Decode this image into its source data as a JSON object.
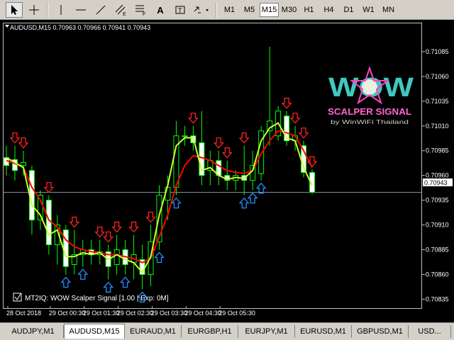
{
  "toolbar": {
    "timeframes": [
      "M1",
      "M5",
      "M15",
      "M30",
      "H1",
      "H4",
      "D1",
      "W1",
      "MN"
    ],
    "selected_timeframe": "M15",
    "text_tool_label": "A"
  },
  "chart": {
    "header": "AUDUSD,M15  0.70963 0.70966 0.70941 0.70943",
    "indicator_label": "MT2IQ: WOW Scalper Signal [1.00 | Exp: 0M]",
    "current_price": "0.70943",
    "logo": {
      "brand": "WOW",
      "tagline": "SCALPER SIGNAL",
      "byline": "by WinWiFi Thailand"
    },
    "colors": {
      "bull": "#00ff00",
      "bear": "#00ff00",
      "fast_line": "#ccff33",
      "slow_line": "#ff0000",
      "up_arrow": "#1e90ff",
      "down_arrow": "#ff2020",
      "bg": "#000000",
      "grid_text": "#ffffff"
    }
  },
  "chart_data": {
    "type": "candlestick",
    "symbol": "AUDUSD",
    "timeframe": "M15",
    "y_ticks": [
      "0.71085",
      "0.71060",
      "0.71035",
      "0.71010",
      "0.70985",
      "0.70960",
      "0.70935",
      "0.70910",
      "0.70885",
      "0.70860",
      "0.70835"
    ],
    "x_ticks": [
      "28 Oct 2018",
      "29 Oct 00:30",
      "29 Oct 01:30",
      "29 Oct 02:30",
      "29 Oct 03:30",
      "29 Oct 04:30",
      "29 Oct 05:30"
    ],
    "ylim": [
      0.70826,
      0.71115
    ],
    "candles": [
      {
        "o": 0.70978,
        "h": 0.7099,
        "l": 0.7096,
        "c": 0.7097
      },
      {
        "o": 0.70976,
        "h": 0.7099,
        "l": 0.70955,
        "c": 0.70965
      },
      {
        "o": 0.7097,
        "h": 0.70985,
        "l": 0.7096,
        "c": 0.70973
      },
      {
        "o": 0.70965,
        "h": 0.7097,
        "l": 0.709,
        "c": 0.70915
      },
      {
        "o": 0.70915,
        "h": 0.70945,
        "l": 0.70905,
        "c": 0.7094
      },
      {
        "o": 0.70935,
        "h": 0.7094,
        "l": 0.7088,
        "c": 0.7089
      },
      {
        "o": 0.7089,
        "h": 0.7092,
        "l": 0.7087,
        "c": 0.7091
      },
      {
        "o": 0.70905,
        "h": 0.7091,
        "l": 0.7086,
        "c": 0.70868
      },
      {
        "o": 0.7087,
        "h": 0.70905,
        "l": 0.7086,
        "c": 0.7088
      },
      {
        "o": 0.7088,
        "h": 0.70895,
        "l": 0.70868,
        "c": 0.70885
      },
      {
        "o": 0.70885,
        "h": 0.70895,
        "l": 0.7087,
        "c": 0.7088
      },
      {
        "o": 0.7088,
        "h": 0.70895,
        "l": 0.7087,
        "c": 0.70883
      },
      {
        "o": 0.70883,
        "h": 0.7089,
        "l": 0.70855,
        "c": 0.70868
      },
      {
        "o": 0.7087,
        "h": 0.709,
        "l": 0.7086,
        "c": 0.70885
      },
      {
        "o": 0.70885,
        "h": 0.70895,
        "l": 0.7086,
        "c": 0.7087
      },
      {
        "o": 0.70872,
        "h": 0.709,
        "l": 0.70855,
        "c": 0.7088
      },
      {
        "o": 0.70875,
        "h": 0.7089,
        "l": 0.70845,
        "c": 0.7086
      },
      {
        "o": 0.7086,
        "h": 0.7091,
        "l": 0.70848,
        "c": 0.70893
      },
      {
        "o": 0.70893,
        "h": 0.7095,
        "l": 0.70885,
        "c": 0.7094
      },
      {
        "o": 0.70935,
        "h": 0.7096,
        "l": 0.70915,
        "c": 0.70948
      },
      {
        "o": 0.70948,
        "h": 0.71015,
        "l": 0.7094,
        "c": 0.71
      },
      {
        "o": 0.71,
        "h": 0.7101,
        "l": 0.7099,
        "c": 0.71
      },
      {
        "o": 0.71,
        "h": 0.7101,
        "l": 0.70985,
        "c": 0.70993
      },
      {
        "o": 0.70993,
        "h": 0.71025,
        "l": 0.7095,
        "c": 0.7096
      },
      {
        "o": 0.70965,
        "h": 0.70985,
        "l": 0.7095,
        "c": 0.70975
      },
      {
        "o": 0.70975,
        "h": 0.70985,
        "l": 0.7095,
        "c": 0.7096
      },
      {
        "o": 0.7096,
        "h": 0.70975,
        "l": 0.70945,
        "c": 0.70955
      },
      {
        "o": 0.70955,
        "h": 0.70965,
        "l": 0.70945,
        "c": 0.7096
      },
      {
        "o": 0.7096,
        "h": 0.7099,
        "l": 0.7094,
        "c": 0.70955
      },
      {
        "o": 0.70955,
        "h": 0.70985,
        "l": 0.70945,
        "c": 0.7097
      },
      {
        "o": 0.70962,
        "h": 0.7101,
        "l": 0.70955,
        "c": 0.71005
      },
      {
        "o": 0.71005,
        "h": 0.7109,
        "l": 0.7099,
        "c": 0.71015
      },
      {
        "o": 0.71,
        "h": 0.7103,
        "l": 0.70995,
        "c": 0.71025
      },
      {
        "o": 0.7102,
        "h": 0.71025,
        "l": 0.7099,
        "c": 0.70995
      },
      {
        "o": 0.70995,
        "h": 0.7101,
        "l": 0.70985,
        "c": 0.71
      },
      {
        "o": 0.7099,
        "h": 0.70995,
        "l": 0.70958,
        "c": 0.70963
      },
      {
        "o": 0.70963,
        "h": 0.70966,
        "l": 0.70941,
        "c": 0.70943
      }
    ],
    "fast_line": [
      0.70978,
      0.70973,
      0.70968,
      0.7093,
      0.7092,
      0.709,
      0.70905,
      0.70878,
      0.70878,
      0.70882,
      0.7088,
      0.70882,
      0.70875,
      0.7088,
      0.70875,
      0.70872,
      0.70862,
      0.70878,
      0.7092,
      0.7095,
      0.7099,
      0.70998,
      0.70998,
      0.70965,
      0.70968,
      0.7096,
      0.70956,
      0.70958,
      0.70957,
      0.70965,
      0.70995,
      0.71008,
      0.71013,
      0.70998,
      0.70995,
      0.70968,
      0.7095
    ],
    "slow_line": [
      0.70975,
      0.70972,
      0.70968,
      0.70948,
      0.70935,
      0.70915,
      0.70908,
      0.70895,
      0.70888,
      0.70885,
      0.70883,
      0.70882,
      0.7088,
      0.7088,
      0.70878,
      0.70876,
      0.70872,
      0.70876,
      0.70898,
      0.7092,
      0.7095,
      0.7097,
      0.7098,
      0.70978,
      0.70975,
      0.7097,
      0.70965,
      0.70963,
      0.70962,
      0.70965,
      0.70982,
      0.70995,
      0.71005,
      0.71003,
      0.71,
      0.70985,
      0.70968
    ],
    "sell_signals": [
      1,
      2,
      5,
      8,
      11,
      12,
      13,
      15,
      17,
      22,
      25,
      26,
      28,
      33,
      34,
      35,
      36
    ],
    "buy_signals": [
      7,
      9,
      12,
      14,
      16,
      18,
      20,
      28,
      29,
      30
    ]
  },
  "tabs": {
    "items": [
      "AUDJPY,M1",
      "AUDUSD,M15",
      "EURAUD,M1",
      "EURGBP,H1",
      "EURJPY,M1",
      "EURUSD,M1",
      "GBPUSD,M1",
      "USD..."
    ],
    "active_index": 1
  }
}
